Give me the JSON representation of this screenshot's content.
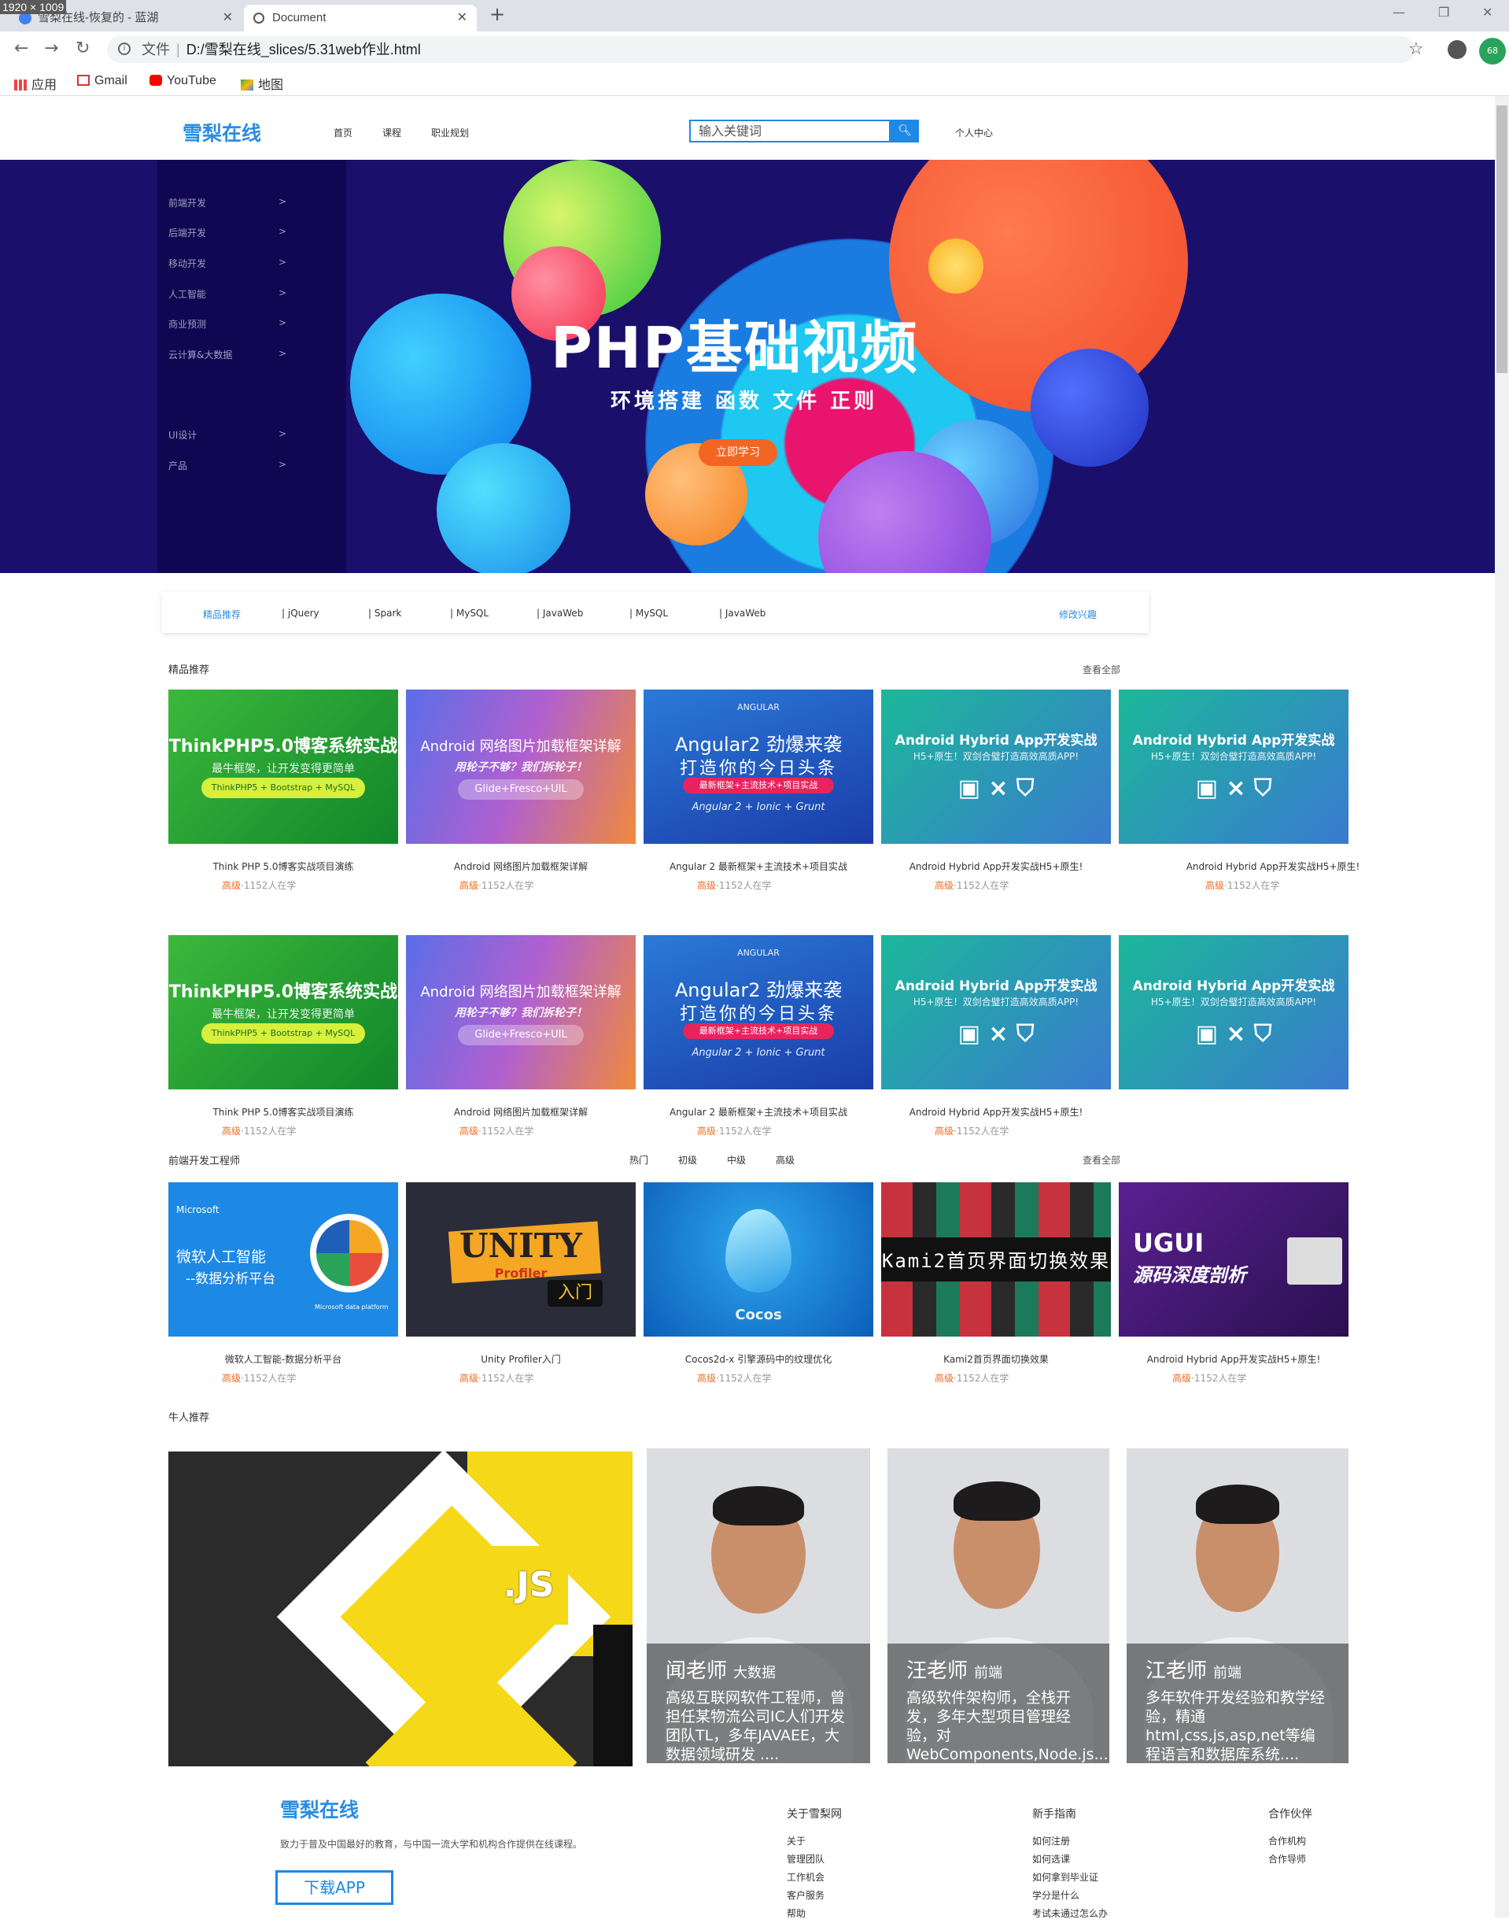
{
  "browser": {
    "dim_label": "1920 × 1009",
    "tabs": [
      {
        "title": "雪梨在线-恢复的 - 蓝湖",
        "active": false
      },
      {
        "title": "Document",
        "active": true
      }
    ],
    "address": {
      "scheme_label": "文件",
      "path": "D:/雪梨在线_slices/5.31web作业.html"
    },
    "extension_badge": "68",
    "bookmarks": [
      "应用",
      "Gmail",
      "YouTube",
      "地图"
    ]
  },
  "header": {
    "logo": "雪梨在线",
    "nav": [
      "首页",
      "课程",
      "职业规划"
    ],
    "search_placeholder": "输入关键词",
    "user_center": "个人中心"
  },
  "banner": {
    "menu": [
      {
        "label": "前端开发",
        "arrow": ">"
      },
      {
        "label": "后端开发",
        "arrow": ">"
      },
      {
        "label": "移动开发",
        "arrow": ">"
      },
      {
        "label": "人工智能",
        "arrow": ">"
      },
      {
        "label": "商业预测",
        "arrow": ">"
      },
      {
        "label": "云计算&大数据",
        "arrow": ">"
      },
      {
        "label": "UI设计",
        "arrow": ">"
      },
      {
        "label": "产品",
        "arrow": ">"
      }
    ],
    "title": "PHP基础视频",
    "subtitle": "环境搭建  函数  文件  正则",
    "button": "立即学习"
  },
  "tags": {
    "items": [
      "精品推荐",
      "| jQuery",
      "| Spark",
      "| MySQL",
      "| JavaWeb",
      "| MySQL",
      "| JavaWeb"
    ],
    "modify": "修改兴趣"
  },
  "featured": {
    "heading": "精品推荐",
    "see_all": "查看全部",
    "row1": [
      {
        "thumb_title": "ThinkPHP5.0博客系统实战",
        "thumb_sub": "最牛框架，让开发变得更简单",
        "thumb_pill": "ThinkPHP5 + Bootstrap + MySQL",
        "title": "Think PHP 5.0博客实战项目演练",
        "level": "高级",
        "count": "·1152人在学"
      },
      {
        "thumb_title": "Android 网络图片加载框架详解",
        "thumb_sub": "用轮子不够？我们拆轮子！",
        "thumb_pill": "Glide+Fresco+UIL",
        "title": "Android 网络图片加载框架详解",
        "level": "高级",
        "count": "·1152人在学"
      },
      {
        "thumb_brand": "ANGULAR",
        "thumb_title": "Angular2 劲爆来袭",
        "thumb_sub": "打造你的今日头条",
        "thumb_pill": "最新框架+主流技术+项目实战",
        "thumb_foot": "Angular 2 + Ionic + Grunt",
        "title": "Angular 2 最新框架+主流技术+项目实战",
        "level": "高级",
        "count": "·1152人在学"
      },
      {
        "thumb_title": "Android Hybrid App开发实战",
        "thumb_sub": "H5+原生！双剑合璧打造高效高质APP!",
        "title": "Android Hybrid App开发实战H5+原生!",
        "level": "高级",
        "count": "·1152人在学"
      },
      {
        "thumb_title": "Android Hybrid App开发实战",
        "thumb_sub": "H5+原生！双剑合璧打造高效高质APP!",
        "title": "Android Hybrid App开发实战H5+原生!",
        "level": "高级",
        "count": "·1152人在学"
      }
    ],
    "row2": [
      {
        "thumb_title": "ThinkPHP5.0博客系统实战",
        "thumb_sub": "最牛框架，让开发变得更简单",
        "thumb_pill": "ThinkPHP5 + Bootstrap + MySQL",
        "title": "Think PHP 5.0博客实战项目演练",
        "level": "高级",
        "count": "·1152人在学"
      },
      {
        "thumb_title": "Android 网络图片加载框架详解",
        "thumb_sub": "用轮子不够？我们拆轮子！",
        "thumb_pill": "Glide+Fresco+UIL",
        "title": "Android 网络图片加载框架详解",
        "level": "高级",
        "count": "·1152人在学"
      },
      {
        "thumb_brand": "ANGULAR",
        "thumb_title": "Angular2 劲爆来袭",
        "thumb_sub": "打造你的今日头条",
        "thumb_pill": "最新框架+主流技术+项目实战",
        "thumb_foot": "Angular 2 + Ionic + Grunt",
        "title": "Angular 2 最新框架+主流技术+项目实战",
        "level": "高级",
        "count": "·1152人在学"
      },
      {
        "thumb_title": "Android Hybrid App开发实战",
        "thumb_sub": "H5+原生！双剑合璧打造高效高质APP!",
        "title": "Android Hybrid App开发实战H5+原生!",
        "level": "高级",
        "count": "·1152人在学"
      },
      {
        "thumb_title": "Android Hybrid App开发实战",
        "thumb_sub": "H5+原生！双剑合璧打造高效高质APP!"
      }
    ]
  },
  "frontend": {
    "heading": "前端开发工程师",
    "filters": [
      "热门",
      "初级",
      "中级",
      "高级"
    ],
    "see_all": "查看全部",
    "cards": [
      {
        "thumb_brand": "Microsoft",
        "thumb_title": "微软人工智能",
        "thumb_sub": "--数据分析平台",
        "thumb_foot": "Microsoft data platform",
        "title": "微软人工智能-数据分析平台",
        "level": "高级",
        "count": "·1152人在学"
      },
      {
        "thumb_title": "UNITY",
        "thumb_sub": "Profiler",
        "thumb_pill": "入门",
        "title": "Unity Profiler入门",
        "level": "高级",
        "count": "·1152人在学"
      },
      {
        "thumb_title": "Cocos",
        "title": "Cocos2d-x 引擎源码中的纹理优化",
        "level": "高级",
        "count": "·1152人在学"
      },
      {
        "thumb_title": "Kami2首页界面切换效果",
        "title": "Kami2首页界面切换效果",
        "level": "高级",
        "count": "·1152人在学"
      },
      {
        "thumb_title": "UGUI",
        "thumb_sub": "源码深度剖析",
        "title": "Android Hybrid App开发实战H5+原生!",
        "level": "高级",
        "count": "·1152人在学"
      }
    ]
  },
  "experts": {
    "heading": "牛人推荐",
    "js_label": ".JS",
    "teachers": [
      {
        "name": "闻老师",
        "field": "大数据",
        "desc": "高级互联网软件工程师，曾担任某物流公司IC人们开发团队TL，多年JAVAEE，大数据领域研发 ...."
      },
      {
        "name": "汪老师",
        "field": "前端",
        "desc": "高级软件架构师，全栈开发，多年大型项目管理经验，对WebComponents,Node.js...."
      },
      {
        "name": "江老师",
        "field": "前端",
        "desc": "多年软件开发经验和教学经验，精通html,css,js,asp,net等编程语言和数据库系统...."
      }
    ]
  },
  "footer": {
    "logo": "雪梨在线",
    "desc": "致力于普及中国最好的教育，与中国一流大学和机构合作提供在线课程。",
    "app_button": "下载APP",
    "columns": [
      {
        "heading": "关于雪梨网",
        "items": [
          "关于",
          "管理团队",
          "工作机会",
          "客户服务",
          "帮助"
        ]
      },
      {
        "heading": "新手指南",
        "items": [
          "如何注册",
          "如何选课",
          "如何拿到毕业证",
          "学分是什么",
          "考试未通过怎么办"
        ]
      },
      {
        "heading": "合作伙伴",
        "items": [
          "合作机构",
          "合作导师"
        ]
      }
    ]
  }
}
